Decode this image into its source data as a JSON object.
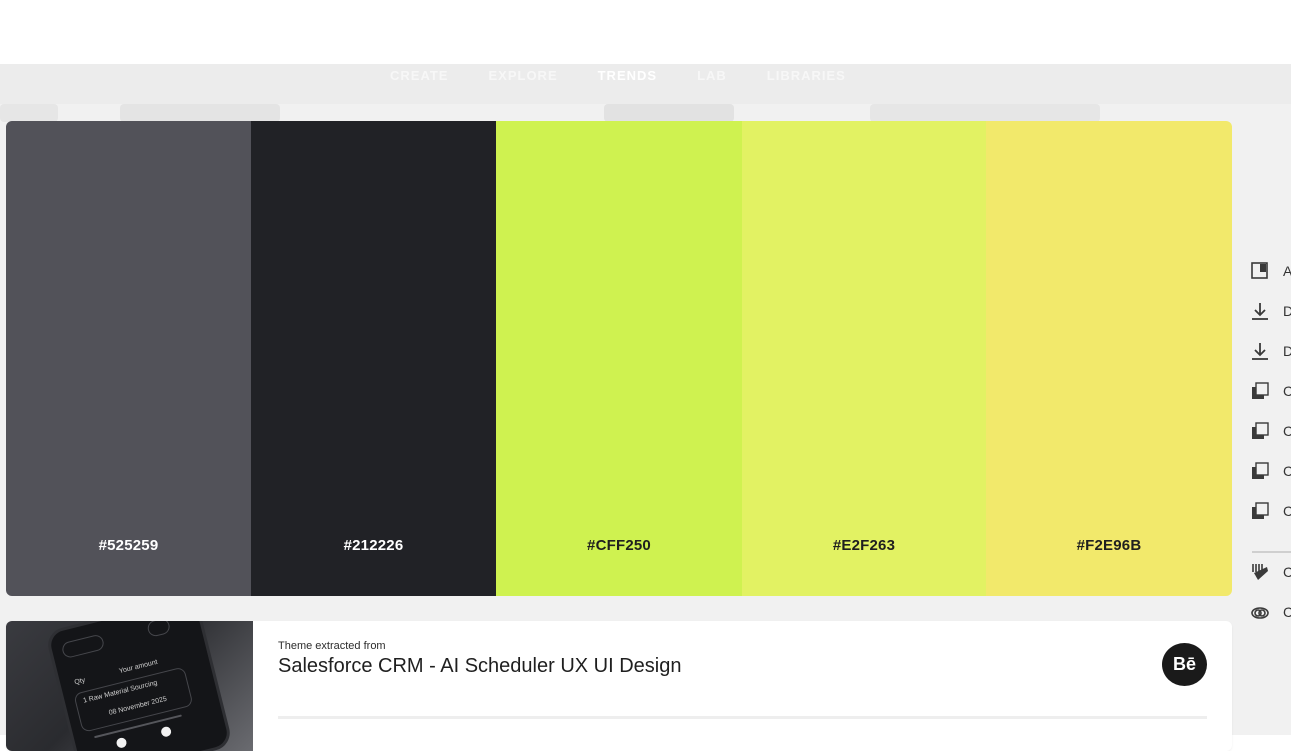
{
  "nav": {
    "tabs": [
      {
        "label": "CREATE"
      },
      {
        "label": "EXPLORE"
      },
      {
        "label": "TRENDS"
      },
      {
        "label": "LAB"
      },
      {
        "label": "LIBRARIES"
      }
    ],
    "active_index": 2
  },
  "palette": {
    "swatches": [
      {
        "hex": "#525259",
        "color": "#525259",
        "text_color": "#ffffff"
      },
      {
        "hex": "#212226",
        "color": "#212226",
        "text_color": "#ffffff"
      },
      {
        "hex": "#CFF250",
        "color": "#CFF250",
        "text_color": "#1f1f1f"
      },
      {
        "hex": "#E2F263",
        "color": "#E2F263",
        "text_color": "#1f1f1f"
      },
      {
        "hex": "#F2E96B",
        "color": "#F2E96B",
        "text_color": "#1f1f1f"
      }
    ]
  },
  "theme": {
    "extracted_label": "Theme extracted from",
    "title": "Salesforce CRM - AI Scheduler UX UI Design",
    "source_badge": "Bē",
    "thumbnail_lines": [
      "1 Raw Material Sourcing",
      "Your amount",
      "Qty",
      "08 November 2025"
    ]
  },
  "side_actions": [
    {
      "icon": "add-to-library-icon",
      "label": "A"
    },
    {
      "icon": "download-icon",
      "label": "D"
    },
    {
      "icon": "download-icon",
      "label": "D"
    },
    {
      "icon": "copy-icon",
      "label": "C"
    },
    {
      "icon": "copy-icon",
      "label": "C"
    },
    {
      "icon": "copy-icon",
      "label": "C"
    },
    {
      "icon": "copy-icon",
      "label": "C"
    },
    {
      "icon": "color-palette-icon",
      "label": "C"
    },
    {
      "icon": "creative-cloud-icon",
      "label": "C"
    }
  ]
}
